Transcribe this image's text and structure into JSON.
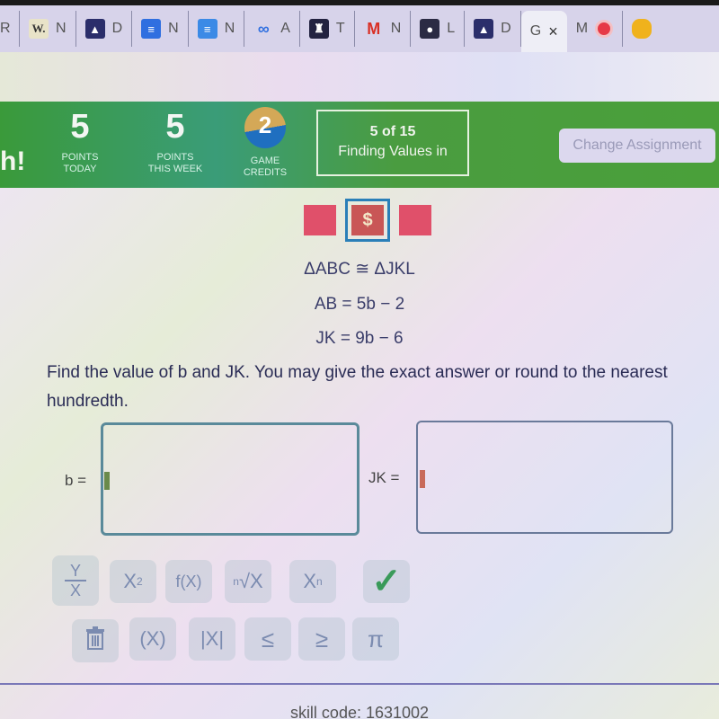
{
  "browser": {
    "tabs": [
      {
        "icon": "partial-tab",
        "label": "R",
        "active": false
      },
      {
        "icon": "wikipedia-icon",
        "glyph": "W.",
        "label": "N",
        "active": false
      },
      {
        "icon": "graduation-cap-icon",
        "glyph": "🎓",
        "label": "D",
        "active": false
      },
      {
        "icon": "docs-icon",
        "glyph": "≡",
        "label": "N",
        "active": false
      },
      {
        "icon": "docs-icon",
        "glyph": "≡",
        "label": "N",
        "active": false
      },
      {
        "icon": "glasses-icon",
        "glyph": "👓",
        "label": "A",
        "active": false
      },
      {
        "icon": "bell-icon",
        "glyph": "🔔",
        "label": "T",
        "active": false
      },
      {
        "icon": "gmail-icon",
        "glyph": "M",
        "label": "N",
        "active": false
      },
      {
        "icon": "person-icon",
        "glyph": "👤",
        "label": "L",
        "active": false
      },
      {
        "icon": "graduation-cap-icon",
        "glyph": "🎓",
        "label": "D",
        "active": false
      },
      {
        "icon": "none",
        "glyph": "",
        "label": "G",
        "active": true,
        "close": "×"
      },
      {
        "icon": "record-icon",
        "glyph": "",
        "label": "M",
        "active": false
      },
      {
        "icon": "extension-icon",
        "glyph": "",
        "label": "",
        "active": false
      }
    ]
  },
  "header": {
    "logo_tail": "h!",
    "points_today": {
      "value": "5",
      "label_line1": "POINTS",
      "label_line2": "TODAY"
    },
    "points_week": {
      "value": "5",
      "label_line1": "POINTS",
      "label_line2": "THIS WEEK"
    },
    "game_credits": {
      "value": "2",
      "label_line1": "GAME",
      "label_line2": "CREDITS"
    },
    "assignment": {
      "count": "5 of 15",
      "name": "Finding Values in"
    },
    "change_assignment": "Change Assignment"
  },
  "progress": {
    "current_symbol": "$",
    "colors": {
      "incorrect": "#e0506a",
      "current": "#c95656",
      "current_border": "#2a7fb8"
    }
  },
  "problem": {
    "given": [
      "ΔABC ≅ ΔJKL",
      "AB = 5b − 2",
      "JK = 9b − 6"
    ],
    "question": "Find the value of b and JK. You may give the exact answer or round to the nearest hundredth."
  },
  "answers": {
    "b": {
      "label": "b =",
      "value": ""
    },
    "jk": {
      "label": "JK =",
      "value": ""
    }
  },
  "keypad": {
    "row1": [
      {
        "name": "fraction",
        "top": "Y",
        "bottom": "X"
      },
      {
        "name": "exponent",
        "base": "X",
        "sup": "2"
      },
      {
        "name": "function",
        "label": "f(X)"
      },
      {
        "name": "nth-root",
        "index": "n",
        "label": "√X"
      },
      {
        "name": "subscript",
        "base": "X",
        "sub": "n"
      },
      {
        "name": "check",
        "label": "✓"
      }
    ],
    "row2": [
      {
        "name": "trash",
        "label": "🗑"
      },
      {
        "name": "parentheses",
        "label": "(X)"
      },
      {
        "name": "absolute-value",
        "label": "|X|"
      },
      {
        "name": "less-equal",
        "label": "≤"
      },
      {
        "name": "greater-equal",
        "label": "≥"
      },
      {
        "name": "pi",
        "label": "π"
      }
    ]
  },
  "footer": {
    "skill_code": "skill code: 1631002"
  }
}
